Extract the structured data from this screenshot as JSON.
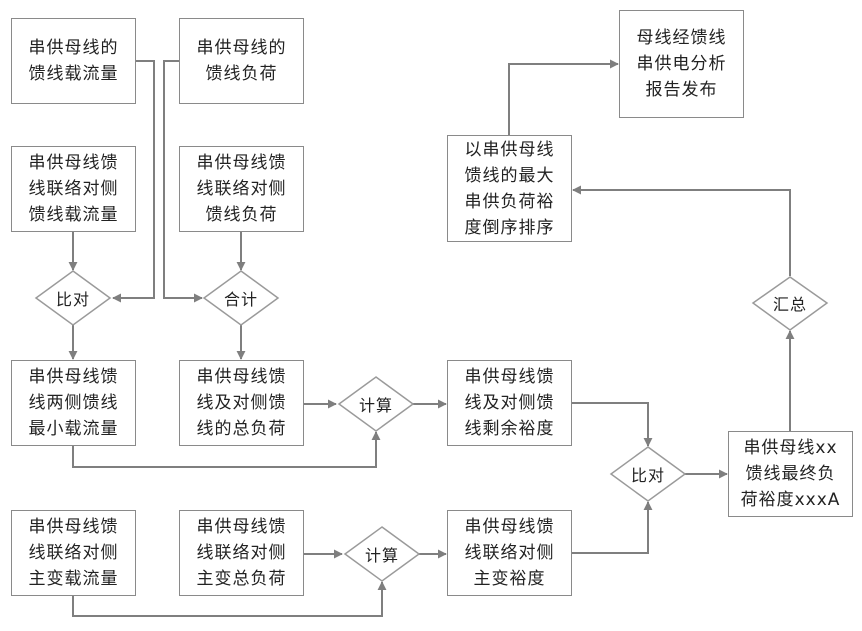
{
  "diagram": {
    "colors": {
      "line": "#7f7f7f",
      "box_border": "#8a8a8a",
      "text": "#222222",
      "background": "#ffffff"
    },
    "boxes": {
      "a1": "串供母线的\n馈线载流量",
      "b1": "串供母线的\n馈线负荷",
      "a2": "串供母线馈\n线联络对侧\n馈线载流量",
      "b2": "串供母线馈\n线联络对侧\n馈线负荷",
      "a3": "串供母线馈\n线两侧馈线\n最小载流量",
      "b3": "串供母线馈\n线及对侧馈\n线的总负荷",
      "c3": "串供母线馈\n线及对侧馈\n线剩余裕度",
      "d": "串供母线xx\n馈线最终负\n荷裕度xxxA",
      "c1": "以串供母线\n馈线的最大\n串供负荷裕\n度倒序排序",
      "e": "母线经馈线\n串供电分析\n报告发布",
      "a4": "串供母线馈\n线联络对侧\n主变载流量",
      "b4": "串供母线馈\n线联络对侧\n主变总负荷",
      "c4": "串供母线馈\n线联络对侧\n主变裕度"
    },
    "decisions": {
      "compare_left": "比对",
      "sum": "合计",
      "calc_mid": "计算",
      "compare_right": "比对",
      "summary": "汇总",
      "calc_bottom": "计算"
    }
  }
}
